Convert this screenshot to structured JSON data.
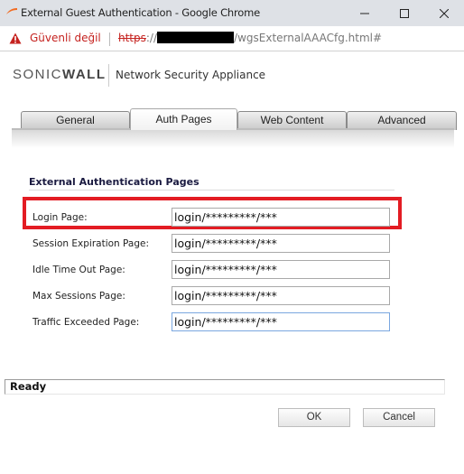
{
  "window": {
    "title": "External Guest Authentication - Google Chrome",
    "icons": {
      "app": "sonicwall-swoosh-icon",
      "minimize": "minimize-icon",
      "maximize": "maximize-icon",
      "close": "close-icon"
    }
  },
  "address_bar": {
    "security_icon": "warning-triangle-icon",
    "security_text": "Güvenli değil",
    "url_scheme": "https",
    "url_sep": "://",
    "url_path": "/wgsExternalAAACfg.html#",
    "colors": {
      "insecure": "#c5221f"
    }
  },
  "header": {
    "logo_light": "SONIC",
    "logo_bold": "WALL",
    "product": "Network Security Appliance",
    "colors": {
      "brand_accent": "#f26b21"
    }
  },
  "tabs": [
    {
      "label": "General",
      "active": false
    },
    {
      "label": "Auth Pages",
      "active": true
    },
    {
      "label": "Web Content",
      "active": false
    },
    {
      "label": "Advanced",
      "active": false
    }
  ],
  "section": {
    "title": "External Authentication Pages",
    "fields": [
      {
        "label": "Login Page:",
        "value": "login/*********/***",
        "highlighted": true
      },
      {
        "label": "Session Expiration Page:",
        "value": "login/*********/***"
      },
      {
        "label": "Idle Time Out Page:",
        "value": "login/*********/***"
      },
      {
        "label": "Max Sessions Page:",
        "value": "login/*********/***"
      },
      {
        "label": "Traffic Exceeded Page:",
        "value": "login/*********/***",
        "focused": true
      }
    ],
    "colors": {
      "highlight_box": "#e31c23"
    }
  },
  "status": {
    "text": "Ready"
  },
  "buttons": {
    "ok": "OK",
    "cancel": "Cancel"
  }
}
